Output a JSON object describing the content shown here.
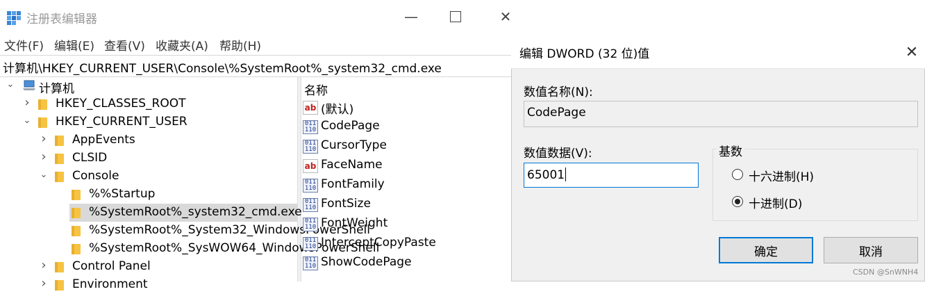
{
  "regedit": {
    "title": "注册表编辑器",
    "menu": [
      "文件(F)",
      "编辑(E)",
      "查看(V)",
      "收藏夹(A)",
      "帮助(H)"
    ],
    "address": "计算机\\HKEY_CURRENT_USER\\Console\\%SystemRoot%_system32_cmd.exe",
    "tree": [
      {
        "label": "计算机",
        "level": 0,
        "chevron": "expanded",
        "icon": "computer-icon"
      },
      {
        "label": "HKEY_CLASSES_ROOT",
        "level": 1,
        "chevron": "collapsed",
        "icon": "folder-icon"
      },
      {
        "label": "HKEY_CURRENT_USER",
        "level": 1,
        "chevron": "expanded",
        "icon": "folder-icon"
      },
      {
        "label": "AppEvents",
        "level": 2,
        "chevron": "collapsed",
        "icon": "folder-icon"
      },
      {
        "label": "CLSID",
        "level": 2,
        "chevron": "collapsed",
        "icon": "folder-icon"
      },
      {
        "label": "Console",
        "level": 2,
        "chevron": "expanded",
        "icon": "folder-icon"
      },
      {
        "label": "%%Startup",
        "level": 3,
        "chevron": "none",
        "icon": "folder-icon"
      },
      {
        "label": "%SystemRoot%_system32_cmd.exe",
        "level": 3,
        "chevron": "none",
        "icon": "folder-icon",
        "selected": true
      },
      {
        "label": "%SystemRoot%_System32_WindowsPowerShell",
        "level": 3,
        "chevron": "none",
        "icon": "folder-icon"
      },
      {
        "label": "%SystemRoot%_SysWOW64_WindowsPowerShell",
        "level": 3,
        "chevron": "none",
        "icon": "folder-icon"
      },
      {
        "label": "Control Panel",
        "level": 2,
        "chevron": "collapsed",
        "icon": "folder-icon"
      },
      {
        "label": "Environment",
        "level": 2,
        "chevron": "collapsed",
        "icon": "folder-icon"
      }
    ],
    "list_header": "名称",
    "values": [
      {
        "name": "(默认)",
        "type": "string"
      },
      {
        "name": "CodePage",
        "type": "binary"
      },
      {
        "name": "CursorType",
        "type": "binary"
      },
      {
        "name": "FaceName",
        "type": "string"
      },
      {
        "name": "FontFamily",
        "type": "binary"
      },
      {
        "name": "FontSize",
        "type": "binary"
      },
      {
        "name": "FontWeight",
        "type": "binary"
      },
      {
        "name": "InterceptCopyPaste",
        "type": "binary"
      },
      {
        "name": "ShowCodePage",
        "type": "binary"
      }
    ],
    "icon_text": {
      "string": "ab",
      "binary": "011\n110"
    }
  },
  "dialog": {
    "title": "编辑 DWORD (32 位)值",
    "name_label": "数值名称(N):",
    "name_value": "CodePage",
    "data_label": "数值数据(V):",
    "data_value": "65001",
    "base_label": "基数",
    "radio_hex": "十六进制(H)",
    "radio_dec": "十进制(D)",
    "selected_base": "decimal",
    "ok": "确定",
    "cancel": "取消"
  },
  "watermark": "CSDN @SnWNH4",
  "colors": {
    "accent": "#0078d7",
    "selection": "#d9d9d9",
    "folder": "#f6c342"
  }
}
